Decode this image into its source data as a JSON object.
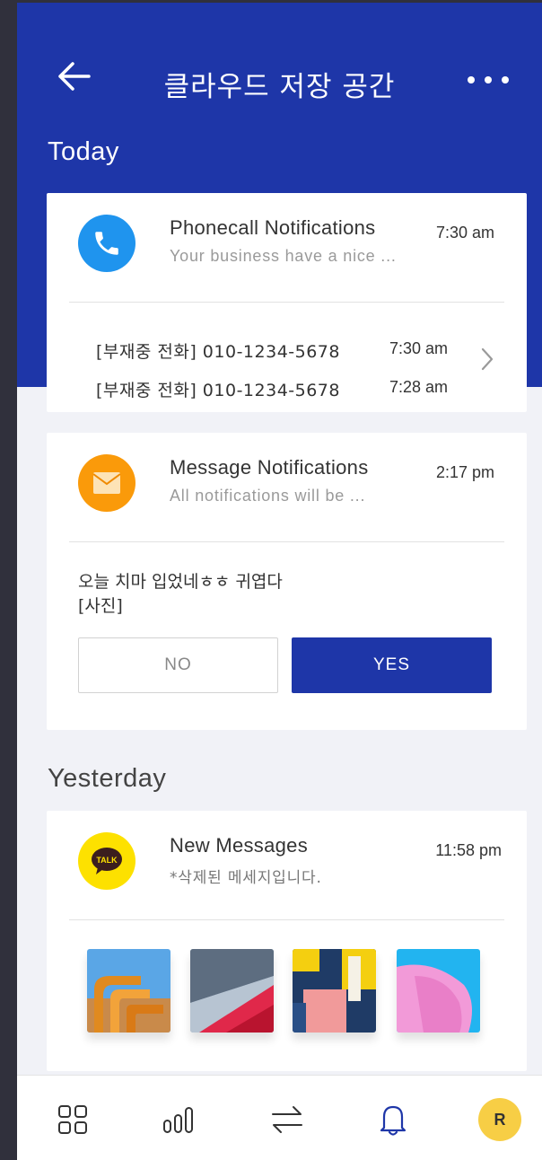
{
  "header": {
    "title": "클라우드 저장 공간"
  },
  "sections": {
    "today": "Today",
    "yesterday": "Yesterday"
  },
  "phonecall": {
    "title": "Phonecall Notifications",
    "subtitle": "Your business have a nice ...",
    "time": "7:30 am",
    "calls": [
      {
        "label": "[부재중 전화] 010-1234-5678",
        "time": "7:30 am"
      },
      {
        "label": "[부재중 전화] 010-1234-5678",
        "time": "7:28 am"
      }
    ]
  },
  "message": {
    "title": "Message Notifications",
    "subtitle": "All notifications will be ...",
    "time": "2:17 pm",
    "body_line1": "오늘 치마 입었네ㅎㅎ 귀엽다",
    "body_line2": "[사진]",
    "no_label": "NO",
    "yes_label": "YES"
  },
  "newmessages": {
    "title": "New Messages",
    "subtitle": "*삭제된 메세지입니다.",
    "time": "11:58 pm",
    "talk_badge": "TALK"
  },
  "nav": {
    "avatar_initial": "R",
    "icons": [
      "grid-icon",
      "bar-chart-icon",
      "swap-icon",
      "bell-icon"
    ]
  },
  "colors": {
    "primary": "#1e36a8",
    "phone_blue": "#1f94ee",
    "mail_orange": "#fa9a0a",
    "kakao_yellow": "#fde100",
    "avatar_yellow": "#f7ce45"
  }
}
